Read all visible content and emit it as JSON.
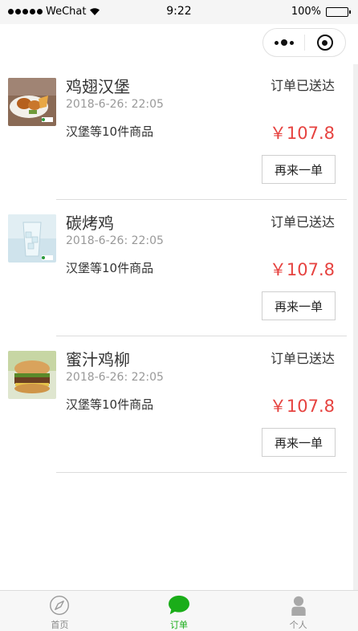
{
  "status_bar": {
    "carrier": "WeChat",
    "time": "9:22",
    "battery": "100%"
  },
  "orders": [
    {
      "name": "鸡翅汉堡",
      "status": "订单已送达",
      "date": "2018-6-26: 22:05",
      "summary": "汉堡等10件商品",
      "price": "￥107.8",
      "reorder_label": "再来一单",
      "thumb_icon": "chicken-wings-food-photo"
    },
    {
      "name": "碳烤鸡",
      "status": "订单已送达",
      "date": "2018-6-26: 22:05",
      "summary": "汉堡等10件商品",
      "price": "￥107.8",
      "reorder_label": "再来一单",
      "thumb_icon": "iced-drink-photo"
    },
    {
      "name": "蜜汁鸡柳",
      "status": "订单已送达",
      "date": "2018-6-26: 22:05",
      "summary": "汉堡等10件商品",
      "price": "￥107.8",
      "reorder_label": "再来一单",
      "thumb_icon": "burger-photo"
    }
  ],
  "tabbar": {
    "items": [
      {
        "label": "首页",
        "icon": "compass-icon",
        "active": false
      },
      {
        "label": "订单",
        "icon": "chat-bubble-icon",
        "active": true
      },
      {
        "label": "个人",
        "icon": "person-icon",
        "active": false
      }
    ]
  },
  "colors": {
    "price": "#e64340",
    "active_tab": "#1aad19",
    "inactive_tab": "#888888"
  }
}
